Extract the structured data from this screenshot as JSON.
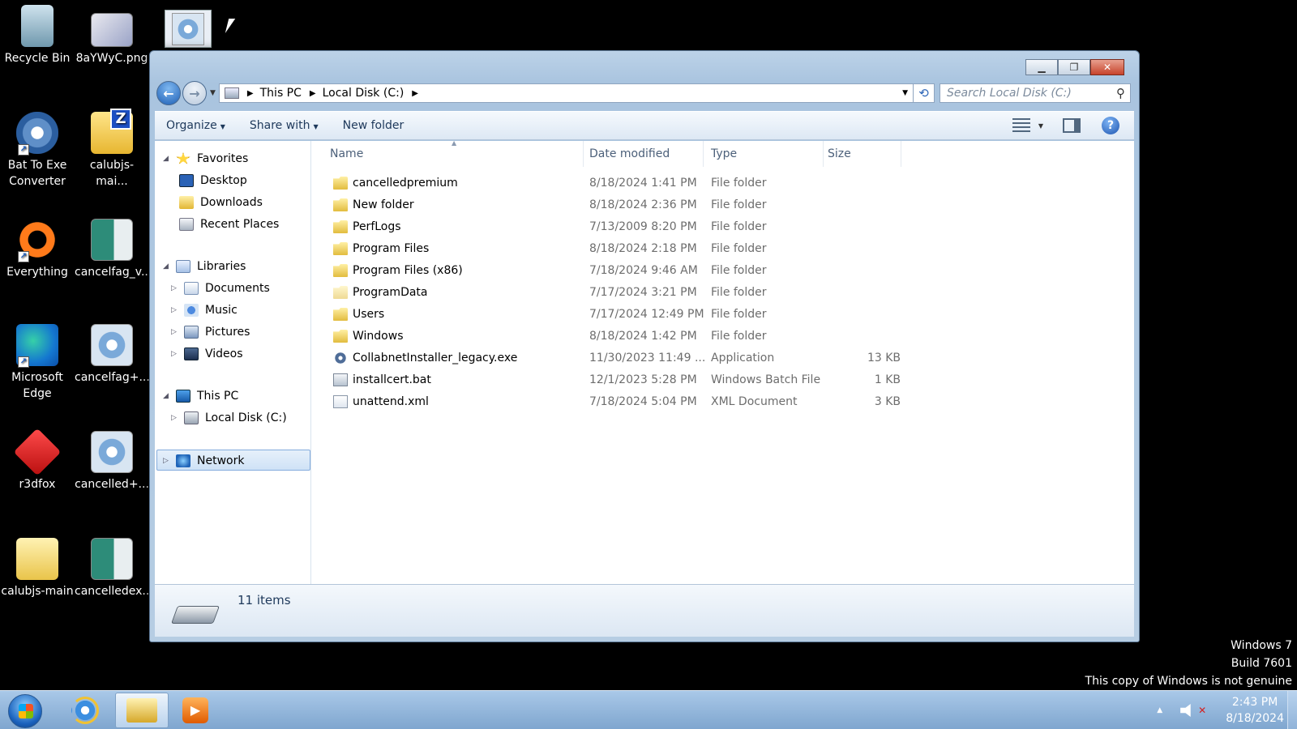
{
  "desktop": {
    "icons": [
      {
        "label": "Recycle Bin",
        "icon": "recycle-bin-icon"
      },
      {
        "label": "8aYWyC.png",
        "icon": "png-image-icon"
      },
      {
        "label": "Bat To Exe\nConverter",
        "icon": "gear-app-icon"
      },
      {
        "label": "calubjs-mai...",
        "icon": "zip-folder-icon"
      },
      {
        "label": "Everything",
        "icon": "everything-search-icon"
      },
      {
        "label": "cancelfag_v...",
        "icon": "image-file-icon"
      },
      {
        "label": "Microsoft\nEdge",
        "icon": "edge-browser-icon"
      },
      {
        "label": "cancelfag+...",
        "icon": "gear-file-icon"
      },
      {
        "label": "r3dfox",
        "icon": "r3dfox-icon"
      },
      {
        "label": "cancelled+...",
        "icon": "gear-file-icon"
      },
      {
        "label": "calubjs-main",
        "icon": "folder-icon"
      },
      {
        "label": "cancelledex...",
        "icon": "image-file-icon"
      }
    ]
  },
  "explorer": {
    "breadcrumb": [
      "This PC",
      "Local Disk (C:)"
    ],
    "search_placeholder": "Search Local Disk (C:)",
    "commands": {
      "organize": "Organize",
      "share_with": "Share with",
      "new_folder": "New folder"
    },
    "nav_tree": {
      "favorites": "Favorites",
      "desktop": "Desktop",
      "downloads": "Downloads",
      "recent_places": "Recent Places",
      "libraries": "Libraries",
      "documents": "Documents",
      "music": "Music",
      "pictures": "Pictures",
      "videos": "Videos",
      "this_pc": "This PC",
      "local_disk": "Local Disk (C:)",
      "network": "Network"
    },
    "columns": {
      "name": "Name",
      "date": "Date modified",
      "type": "Type",
      "size": "Size"
    },
    "files": [
      {
        "name": "cancelledpremium",
        "date": "8/18/2024 1:41 PM",
        "type": "File folder",
        "size": "",
        "icon": "folder-icon"
      },
      {
        "name": "New folder",
        "date": "8/18/2024 2:36 PM",
        "type": "File folder",
        "size": "",
        "icon": "folder-icon"
      },
      {
        "name": "PerfLogs",
        "date": "7/13/2009 8:20 PM",
        "type": "File folder",
        "size": "",
        "icon": "folder-icon"
      },
      {
        "name": "Program Files",
        "date": "8/18/2024 2:18 PM",
        "type": "File folder",
        "size": "",
        "icon": "folder-icon"
      },
      {
        "name": "Program Files (x86)",
        "date": "7/18/2024 9:46 AM",
        "type": "File folder",
        "size": "",
        "icon": "folder-icon"
      },
      {
        "name": "ProgramData",
        "date": "7/17/2024 3:21 PM",
        "type": "File folder",
        "size": "",
        "icon": "folder-icon"
      },
      {
        "name": "Users",
        "date": "7/17/2024 12:49 PM",
        "type": "File folder",
        "size": "",
        "icon": "folder-icon"
      },
      {
        "name": "Windows",
        "date": "8/18/2024 1:42 PM",
        "type": "File folder",
        "size": "",
        "icon": "folder-icon"
      },
      {
        "name": "CollabnetInstaller_legacy.exe",
        "date": "11/30/2023 11:49 ...",
        "type": "Application",
        "size": "13 KB",
        "icon": "application-icon"
      },
      {
        "name": "installcert.bat",
        "date": "12/1/2023 5:28 PM",
        "type": "Windows Batch File",
        "size": "1 KB",
        "icon": "batch-file-icon"
      },
      {
        "name": "unattend.xml",
        "date": "7/18/2024 5:04 PM",
        "type": "XML Document",
        "size": "3 KB",
        "icon": "xml-file-icon"
      }
    ],
    "status_count": "11 items"
  },
  "watermark": {
    "line1": "Windows 7",
    "line2": "Build 7601",
    "line3": "This copy of Windows is not genuine"
  },
  "taskbar": {
    "time": "2:43 PM",
    "date": "8/18/2024"
  },
  "colors": {
    "desktop_bg": "#000000",
    "selection": "#cfe2f6",
    "accent": "#1e5fb5"
  }
}
